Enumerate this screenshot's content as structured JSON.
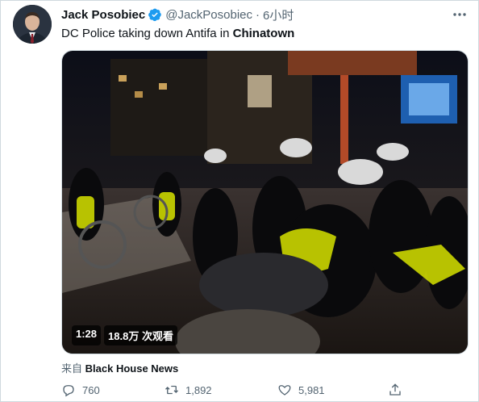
{
  "tweet": {
    "author_name": "Jack Posobiec",
    "handle": "@JackPosobiec",
    "separator": "·",
    "time": "6小时",
    "text_prefix": "DC Police taking down Antifa in ",
    "text_bold": "Chinatown",
    "source_prefix": "来自",
    "source_name": "Black House News"
  },
  "video": {
    "duration": "1:28",
    "views": "18.8万 次观看"
  },
  "actions": {
    "reply_count": "760",
    "retweet_count": "1,892",
    "like_count": "5,981"
  },
  "colors": {
    "verified": "#1d9bf0",
    "text_primary": "#0f1419",
    "text_secondary": "#536471",
    "border": "#cfd9de"
  },
  "icons": [
    "verified-badge-icon",
    "more-options-icon",
    "reply-icon",
    "retweet-icon",
    "like-icon",
    "share-icon"
  ]
}
